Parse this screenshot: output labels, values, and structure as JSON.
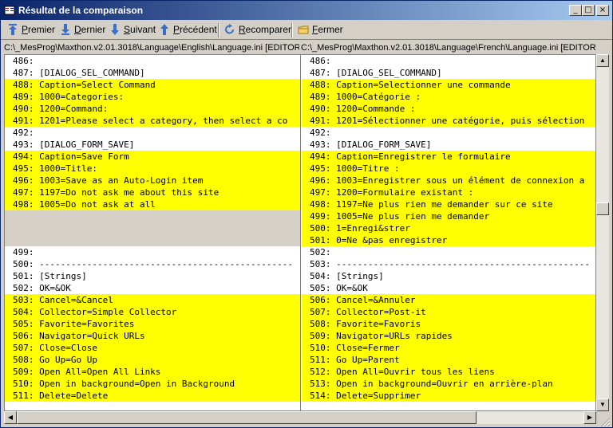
{
  "window": {
    "title": "Résultat de la comparaison"
  },
  "controls": {
    "minimize": "_",
    "maximize": "□",
    "close": "×"
  },
  "toolbar": {
    "first": "Premier",
    "last": "Dernier",
    "next": "Suivant",
    "prev": "Précédent",
    "recompare": "Recomparer",
    "close": "Fermer"
  },
  "paths": {
    "left": "C:\\_MesProg\\Maxthon.v2.01.3018\\Language\\English\\Language.ini [EDITOR]",
    "right": "C:\\_MesProg\\Maxthon.v2.01.3018\\Language\\French\\Language.ini [EDITOR]"
  },
  "colors": {
    "changed": "#ffff00",
    "gap": "#d4d0c8",
    "title_start": "#0a246a",
    "title_end": "#a6caf0"
  },
  "left_lines": [
    {
      "text": "486:",
      "state": "same"
    },
    {
      "text": "487: [DIALOG_SEL_COMMAND]",
      "state": "same"
    },
    {
      "text": "488: Caption=Select Command",
      "state": "changed"
    },
    {
      "text": "489: 1000=Categories:",
      "state": "changed"
    },
    {
      "text": "490: 1200=Command:",
      "state": "changed"
    },
    {
      "text": "491: 1201=Please select a category, then select a co",
      "state": "changed"
    },
    {
      "text": "492:",
      "state": "same"
    },
    {
      "text": "493: [DIALOG_FORM_SAVE]",
      "state": "same"
    },
    {
      "text": "494: Caption=Save Form",
      "state": "changed"
    },
    {
      "text": "495: 1000=Title:",
      "state": "changed"
    },
    {
      "text": "496: 1003=Save as an Auto-Login item",
      "state": "changed"
    },
    {
      "text": "497: 1197=Do not ask me about this site",
      "state": "changed"
    },
    {
      "text": "498: 1005=Do not ask at all",
      "state": "changed"
    },
    {
      "text": "",
      "state": "gap"
    },
    {
      "text": "",
      "state": "gap"
    },
    {
      "text": "",
      "state": "gap"
    },
    {
      "text": "499:",
      "state": "same"
    },
    {
      "text": "500: ------------------------------------------------",
      "state": "same"
    },
    {
      "text": "501: [Strings]",
      "state": "same"
    },
    {
      "text": "502: OK=&OK",
      "state": "same"
    },
    {
      "text": "503: Cancel=&Cancel",
      "state": "changed"
    },
    {
      "text": "504: Collector=Simple Collector",
      "state": "changed"
    },
    {
      "text": "505: Favorite=Favorites",
      "state": "changed"
    },
    {
      "text": "506: Navigator=Quick URLs",
      "state": "changed"
    },
    {
      "text": "507: Close=Close",
      "state": "changed"
    },
    {
      "text": "508: Go Up=Go Up",
      "state": "changed"
    },
    {
      "text": "509: Open All=Open All Links",
      "state": "changed"
    },
    {
      "text": "510: Open in background=Open in Background",
      "state": "changed"
    },
    {
      "text": "511: Delete=Delete",
      "state": "changed"
    }
  ],
  "right_lines": [
    {
      "text": "486:",
      "state": "same"
    },
    {
      "text": "487: [DIALOG_SEL_COMMAND]",
      "state": "same"
    },
    {
      "text": "488: Caption=Selectionner une commande",
      "state": "changed"
    },
    {
      "text": "489: 1000=Catégorie :",
      "state": "changed"
    },
    {
      "text": "490: 1200=Commande :",
      "state": "changed"
    },
    {
      "text": "491: 1201=Sélectionner une catégorie, puis sélection",
      "state": "changed"
    },
    {
      "text": "492:",
      "state": "same"
    },
    {
      "text": "493: [DIALOG_FORM_SAVE]",
      "state": "same"
    },
    {
      "text": "494: Caption=Enregistrer le formulaire",
      "state": "changed"
    },
    {
      "text": "495: 1000=Titre :",
      "state": "changed"
    },
    {
      "text": "496: 1003=Enregistrer sous un élément de connexion a",
      "state": "changed"
    },
    {
      "text": "497: 1200=Formulaire existant :",
      "state": "changed"
    },
    {
      "text": "498: 1197=Ne plus rien me demander sur ce site",
      "state": "changed"
    },
    {
      "text": "499: 1005=Ne plus rien me demander",
      "state": "changed"
    },
    {
      "text": "500: 1=Enregi&strer",
      "state": "changed"
    },
    {
      "text": "501: 0=Ne &pas enregistrer",
      "state": "changed"
    },
    {
      "text": "502:",
      "state": "same"
    },
    {
      "text": "503: ------------------------------------------------",
      "state": "same"
    },
    {
      "text": "504: [Strings]",
      "state": "same"
    },
    {
      "text": "505: OK=&OK",
      "state": "same"
    },
    {
      "text": "506: Cancel=&Annuler",
      "state": "changed"
    },
    {
      "text": "507: Collector=Post-it",
      "state": "changed"
    },
    {
      "text": "508: Favorite=Favoris",
      "state": "changed"
    },
    {
      "text": "509: Navigator=URLs rapides",
      "state": "changed"
    },
    {
      "text": "510: Close=Fermer",
      "state": "changed"
    },
    {
      "text": "511: Go Up=Parent",
      "state": "changed"
    },
    {
      "text": "512: Open All=Ouvrir tous les liens",
      "state": "changed"
    },
    {
      "text": "513: Open in background=Ouvrir en arrière-plan",
      "state": "changed"
    },
    {
      "text": "514: Delete=Supprimer",
      "state": "changed"
    }
  ]
}
